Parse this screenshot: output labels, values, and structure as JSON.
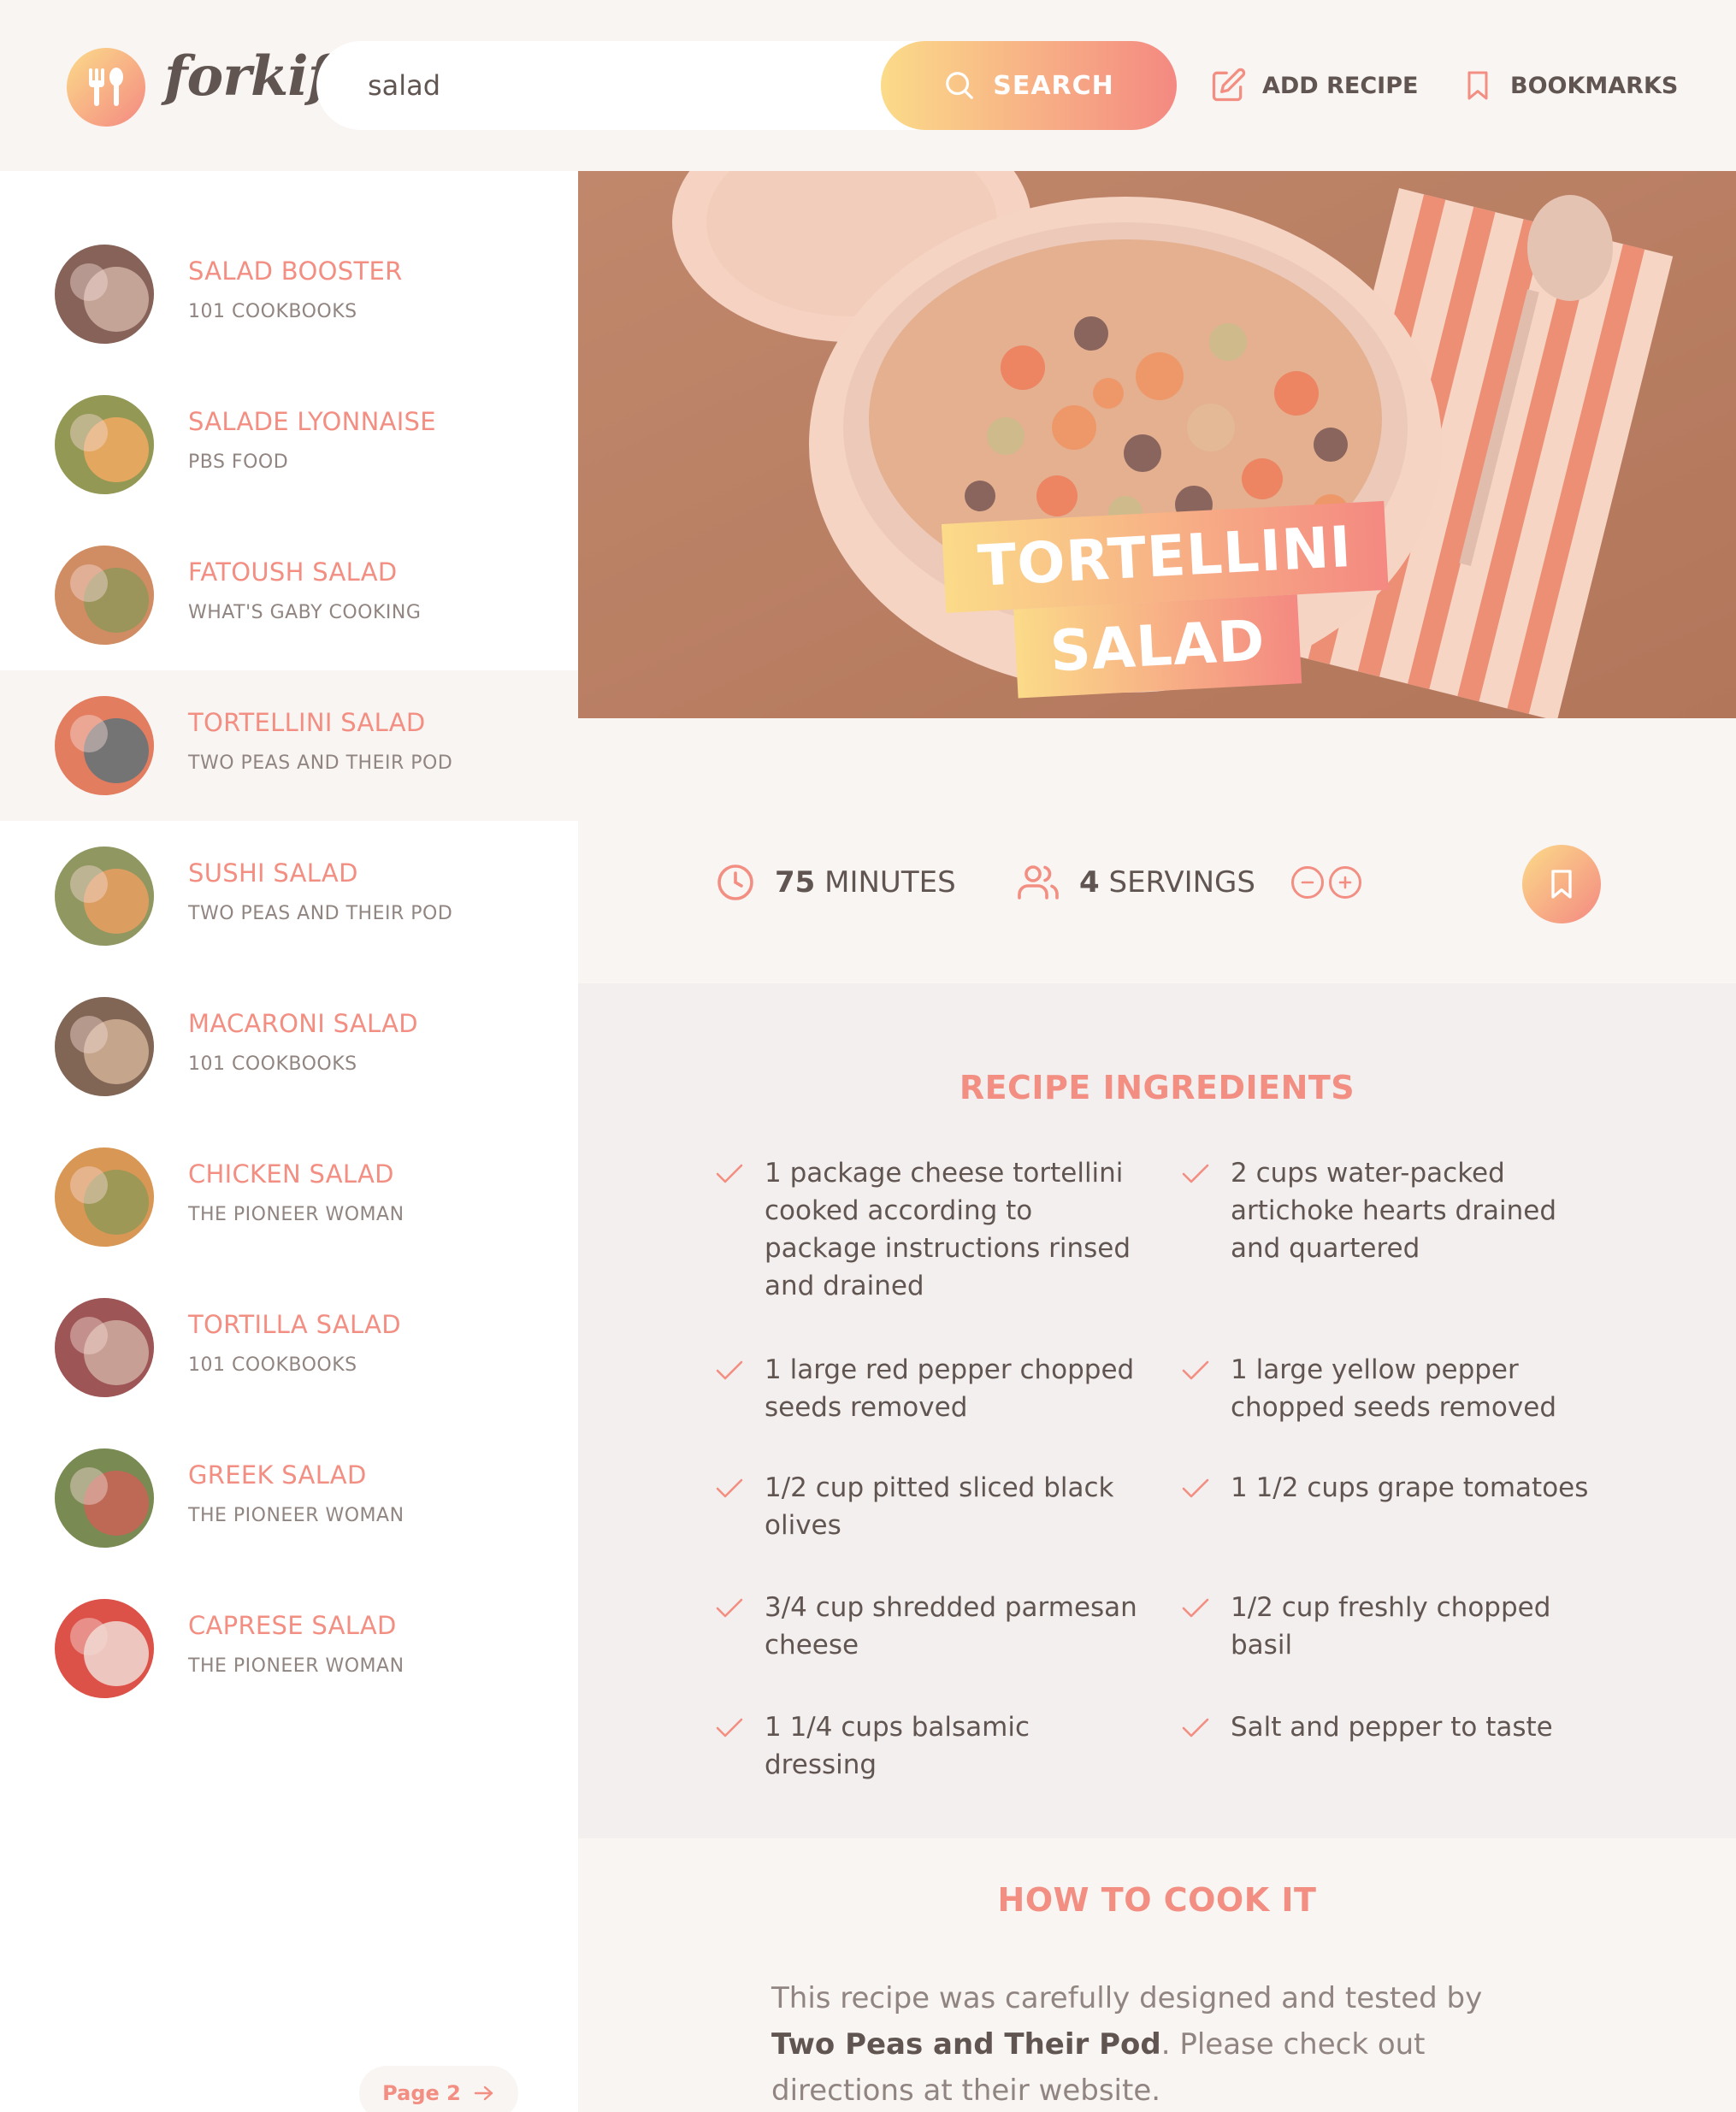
{
  "app": {
    "logo_text": "forkify",
    "search": {
      "value": "salad",
      "button_label": "SEARCH"
    },
    "nav": {
      "add_recipe": "ADD RECIPE",
      "bookmarks": "BOOKMARKS"
    }
  },
  "results": [
    {
      "title": "SALAD BOOSTER",
      "publisher": "101 COOKBOOKS",
      "active": false
    },
    {
      "title": "SALADE LYONNAISE",
      "publisher": "PBS FOOD",
      "active": false
    },
    {
      "title": "FATOUSH SALAD",
      "publisher": "WHAT'S GABY COOKING",
      "active": false
    },
    {
      "title": "TORTELLINI SALAD",
      "publisher": "TWO PEAS AND THEIR POD",
      "active": true
    },
    {
      "title": "SUSHI SALAD",
      "publisher": "TWO PEAS AND THEIR POD",
      "active": false
    },
    {
      "title": "MACARONI SALAD",
      "publisher": "101 COOKBOOKS",
      "active": false
    },
    {
      "title": "CHICKEN SALAD",
      "publisher": "THE PIONEER WOMAN",
      "active": false
    },
    {
      "title": "TORTILLA SALAD",
      "publisher": "101 COOKBOOKS",
      "active": false
    },
    {
      "title": "GREEK SALAD",
      "publisher": "THE PIONEER WOMAN",
      "active": false
    },
    {
      "title": "CAPRESE SALAD",
      "publisher": "THE PIONEER WOMAN",
      "active": false
    }
  ],
  "pagination": {
    "next_label": "Page 2"
  },
  "recipe": {
    "title_line1": "TORTELLINI",
    "title_line2": "SALAD",
    "minutes": "75",
    "minutes_label": "MINUTES",
    "servings": "4",
    "servings_label": "SERVINGS",
    "ingredients_title": "RECIPE INGREDIENTS",
    "ingredients": [
      {
        "qty": "1",
        "desc": "package cheese tortellini cooked according to package instructions rinsed and drained"
      },
      {
        "qty": "2",
        "desc": "cups water-packed artichoke hearts drained and quartered"
      },
      {
        "qty": "1",
        "desc": "large red pepper chopped seeds removed"
      },
      {
        "qty": "1",
        "desc": "large yellow pepper chopped seeds removed"
      },
      {
        "qty": "1/2",
        "desc": "cup pitted sliced black olives"
      },
      {
        "qty": "1 1/2",
        "desc": "cups grape tomatoes"
      },
      {
        "qty": "3/4",
        "desc": "cup shredded parmesan cheese"
      },
      {
        "qty": "1/2",
        "desc": "cup freshly chopped basil"
      },
      {
        "qty": "1 1/4",
        "desc": "cups balsamic dressing"
      },
      {
        "qty": "",
        "desc": "Salt and pepper to taste"
      }
    ],
    "cook_title": "HOW TO COOK IT",
    "cook_text_1": "This recipe was carefully designed and tested by ",
    "cook_publisher": "Two Peas and Their Pod",
    "cook_text_2": ". Please check out directions at their website."
  },
  "colors": {
    "accent": "#f38e82",
    "gradient_start": "#fbdb89",
    "gradient_end": "#f48982",
    "text": "#615551"
  },
  "icons": {
    "logo": "fork-spoon-icon",
    "search": "search-icon",
    "add": "edit-icon",
    "bookmark": "bookmark-icon",
    "time": "clock-icon",
    "servings": "users-icon",
    "minus": "minus-circle-icon",
    "plus": "plus-circle-icon",
    "check": "check-icon",
    "arrow": "arrow-right-icon"
  }
}
